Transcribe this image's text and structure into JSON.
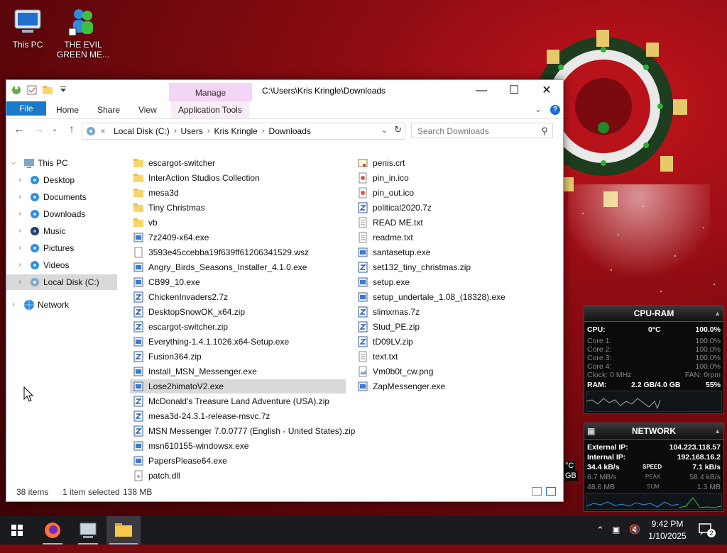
{
  "desktop": {
    "icons": [
      {
        "label": "This PC",
        "icon": "monitor-icon"
      },
      {
        "label": "THE EVIL GREEN ME...",
        "icon": "msn-buddy-icon"
      }
    ]
  },
  "window": {
    "quick_access_icons": [
      "properties-icon",
      "new-folder-icon",
      "customize-qat-icon"
    ],
    "manage_tab": "Manage",
    "title": "C:\\Users\\Kris Kringle\\Downloads",
    "ribbon_tabs": [
      "File",
      "Home",
      "Share",
      "View",
      "Application Tools"
    ],
    "address": {
      "prefix": "«",
      "crumbs": [
        "Local Disk (C:)",
        "Users",
        "Kris Kringle",
        "Downloads"
      ]
    },
    "search_placeholder": "Search Downloads",
    "nav": [
      {
        "label": "This PC",
        "icon": "monitor-icon",
        "level": 0,
        "expanded": true
      },
      {
        "label": "Desktop",
        "icon": "desktop-icon",
        "level": 1
      },
      {
        "label": "Documents",
        "icon": "documents-icon",
        "level": 1
      },
      {
        "label": "Downloads",
        "icon": "downloads-icon",
        "level": 1
      },
      {
        "label": "Music",
        "icon": "music-icon",
        "level": 1
      },
      {
        "label": "Pictures",
        "icon": "pictures-icon",
        "level": 1
      },
      {
        "label": "Videos",
        "icon": "videos-icon",
        "level": 1
      },
      {
        "label": "Local Disk (C:)",
        "icon": "disk-icon",
        "level": 1,
        "selected": true
      },
      {
        "label": "Network",
        "icon": "network-icon",
        "level": 0
      }
    ],
    "files_col1": [
      {
        "name": "escargot-switcher",
        "type": "folder"
      },
      {
        "name": "InterAction Studios Collection",
        "type": "folder"
      },
      {
        "name": "mesa3d",
        "type": "folder"
      },
      {
        "name": "Tiny Christmas",
        "type": "folder"
      },
      {
        "name": "vb",
        "type": "folder"
      },
      {
        "name": "7z2409-x64.exe",
        "type": "exe"
      },
      {
        "name": "3593e45ccebba19f639ff61206341529.wsz",
        "type": "file"
      },
      {
        "name": "Angry_Birds_Seasons_Installer_4.1.0.exe",
        "type": "exe"
      },
      {
        "name": "CB99_10.exe",
        "type": "exe"
      },
      {
        "name": "ChickenInvaders2.7z",
        "type": "archive"
      },
      {
        "name": "DesktopSnowOK_x64.zip",
        "type": "archive"
      },
      {
        "name": "escargot-switcher.zip",
        "type": "archive"
      },
      {
        "name": "Everything-1.4.1.1026.x64-Setup.exe",
        "type": "exe"
      },
      {
        "name": "Fusion364.zip",
        "type": "archive"
      },
      {
        "name": "Install_MSN_Messenger.exe",
        "type": "exe"
      },
      {
        "name": "Lose2himatoV2.exe",
        "type": "exe",
        "selected": true
      },
      {
        "name": "McDonald's Treasure Land Adventure (USA).zip",
        "type": "archive"
      },
      {
        "name": "mesa3d-24.3.1-release-msvc.7z",
        "type": "archive"
      },
      {
        "name": "MSN Messenger 7.0.0777 (English - United States).zip",
        "type": "archive"
      },
      {
        "name": "msn610155-windowsx.exe",
        "type": "exe"
      },
      {
        "name": "PapersPlease64.exe",
        "type": "exe"
      },
      {
        "name": "patch.dll",
        "type": "dll"
      }
    ],
    "files_col2": [
      {
        "name": "penis.crt",
        "type": "cert"
      },
      {
        "name": "pin_in.ico",
        "type": "ico"
      },
      {
        "name": "pin_out.ico",
        "type": "ico"
      },
      {
        "name": "political2020.7z",
        "type": "archive"
      },
      {
        "name": "READ ME.txt",
        "type": "text"
      },
      {
        "name": "readme.txt",
        "type": "text"
      },
      {
        "name": "santasetup.exe",
        "type": "exe"
      },
      {
        "name": "set132_tiny_christmas.zip",
        "type": "archive"
      },
      {
        "name": "setup.exe",
        "type": "exe"
      },
      {
        "name": "setup_undertale_1.08_(18328).exe",
        "type": "exe"
      },
      {
        "name": "slimxmas.7z",
        "type": "archive"
      },
      {
        "name": "Stud_PE.zip",
        "type": "archive"
      },
      {
        "name": "tD09LV.zip",
        "type": "archive"
      },
      {
        "name": "text.txt",
        "type": "text"
      },
      {
        "name": "Vm0b0t_cw.png",
        "type": "image"
      },
      {
        "name": "ZapMessenger.exe",
        "type": "exe"
      }
    ],
    "status": {
      "items": "38 items",
      "selected": "1 item selected",
      "size": "138 MB"
    }
  },
  "gadgets": {
    "cpu": {
      "title": "CPU-RAM",
      "cpu_label": "CPU:",
      "temp": "0°C",
      "cpu_pct": "100.0%",
      "cores": [
        {
          "label": "Core 1:",
          "value": "100.0%",
          "level": 1.0
        },
        {
          "label": "Core 2:",
          "value": "100.0%",
          "level": 1.0
        },
        {
          "label": "Core 3:",
          "value": "100.0%",
          "level": 1.0
        },
        {
          "label": "Core 4:",
          "value": "100.0%",
          "level": 1.0
        }
      ],
      "clock": "Clock: 0 MHz",
      "fan": "FAN: 0rpm",
      "ram_label": "RAM:",
      "ram_used": "2.2 GB/4.0 GB",
      "ram_pct": "55%"
    },
    "network": {
      "title": "NETWORK",
      "external_label": "External IP:",
      "external_ip": "104.223.118.57",
      "internal_label": "Internal IP:",
      "internal_ip": "192.168.16.2",
      "speed_down": "34.4 kB/s",
      "speed_label": "SPEED",
      "speed_up": "7.1 kB/s",
      "peak_down": "6.7 MB/s",
      "peak_label": "PEAK",
      "peak_up": "58.4 kB/s",
      "sum_down": "48.6 MB",
      "sum_label": "SUM",
      "sum_up": "1.3 MB"
    },
    "partial_texts": [
      "°C",
      "GB"
    ]
  },
  "taskbar": {
    "apps": [
      {
        "name": "start",
        "icon": "windows-logo-icon"
      },
      {
        "name": "firefox",
        "icon": "firefox-icon"
      },
      {
        "name": "pc",
        "icon": "computer-icon"
      },
      {
        "name": "explorer",
        "icon": "file-explorer-icon"
      }
    ],
    "time": "9:42 PM",
    "date": "1/10/2025",
    "notification_count": "2"
  },
  "colors": {
    "accent": "#1979ca",
    "manage": "#f3d5f5",
    "selection": "#d9d9d9",
    "taskbar": "#1b1b1f"
  }
}
